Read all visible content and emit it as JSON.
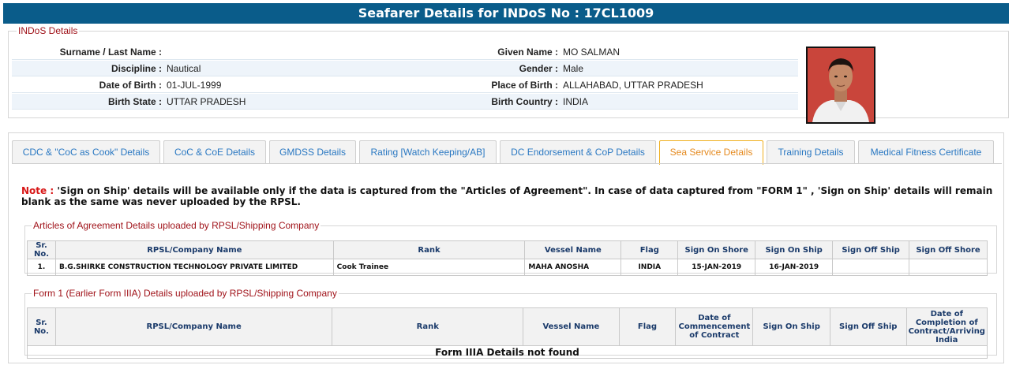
{
  "title": "Seafarer Details for INDoS No : 17CL1009",
  "indos": {
    "legend": "INDoS Details",
    "rows": [
      {
        "l1": "Surname / Last Name :",
        "v1": "",
        "l2": "Given Name :",
        "v2": "MO SALMAN"
      },
      {
        "l1": "Discipline :",
        "v1": "Nautical",
        "l2": "Gender :",
        "v2": "Male"
      },
      {
        "l1": "Date of Birth :",
        "v1": "01-JUL-1999",
        "l2": "Place of Birth :",
        "v2": "ALLAHABAD, UTTAR PRADESH"
      },
      {
        "l1": "Birth State :",
        "v1": "UTTAR PRADESH",
        "l2": "Birth Country :",
        "v2": "INDIA"
      }
    ]
  },
  "tabs": [
    {
      "label": "CDC & \"CoC as Cook\" Details"
    },
    {
      "label": "CoC & CoE Details"
    },
    {
      "label": "GMDSS Details"
    },
    {
      "label": "Rating [Watch Keeping/AB]"
    },
    {
      "label": "DC Endorsement & CoP Details"
    },
    {
      "label": "Sea Service Details"
    },
    {
      "label": "Training Details"
    },
    {
      "label": "Medical Fitness Certificate"
    }
  ],
  "active_tab": "Sea Service Details",
  "note": {
    "label": "Note :",
    "text": "'Sign on Ship' details will be available only if the data is captured from the \"Articles of Agreement\". In case of data captured from \"FORM 1\" , 'Sign on Ship' details will remain blank as the same was never uploaded by the RPSL."
  },
  "articles": {
    "legend": "Articles of Agreement Details uploaded by RPSL/Shipping Company",
    "headers": [
      "Sr. No.",
      "RPSL/Company Name",
      "Rank",
      "Vessel Name",
      "Flag",
      "Sign On Shore",
      "Sign On Ship",
      "Sign Off Ship",
      "Sign Off Shore"
    ],
    "rows": [
      [
        "1.",
        "B.G.SHIRKE CONSTRUCTION TECHNOLOGY PRIVATE LIMITED",
        "Cook Trainee",
        "MAHA ANOSHA",
        "INDIA",
        "15-JAN-2019",
        "16-JAN-2019",
        "",
        ""
      ]
    ]
  },
  "form1": {
    "legend": "Form 1 (Earlier Form IIIA) Details uploaded by RPSL/Shipping Company",
    "headers": [
      "Sr. No.",
      "RPSL/Company Name",
      "Rank",
      "Vessel Name",
      "Flag",
      "Date of Commencement of Contract",
      "Sign On Ship",
      "Sign Off Ship",
      "Date of Completion of Contract/Arriving India"
    ],
    "empty_message": "Form IIIA Details not found"
  },
  "colors": {
    "header_bg": "#0a5c8a",
    "legend_text": "#a0131a",
    "tab_text": "#2a78c2",
    "active_tab_text": "#e58a1f",
    "note_label": "#d81818"
  }
}
